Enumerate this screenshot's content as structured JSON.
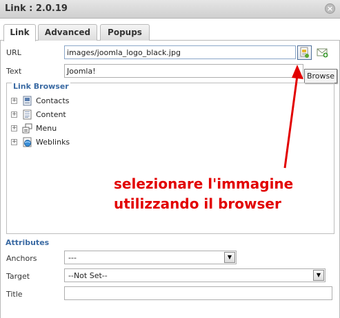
{
  "window": {
    "title": "Link : 2.0.19",
    "close_glyph": "×"
  },
  "tabs": [
    {
      "label": "Link",
      "active": true
    },
    {
      "label": "Advanced",
      "active": false
    },
    {
      "label": "Popups",
      "active": false
    }
  ],
  "form": {
    "url_label": "URL",
    "url_value": "images/joomla_logo_black.jpg",
    "text_label": "Text",
    "text_value": "Joomla!"
  },
  "tooltip": {
    "label": "Browse"
  },
  "link_browser": {
    "legend": "Link Browser",
    "items": [
      {
        "label": "Contacts",
        "icon": "contacts-icon"
      },
      {
        "label": "Content",
        "icon": "content-icon"
      },
      {
        "label": "Menu",
        "icon": "menu-icon"
      },
      {
        "label": "Weblinks",
        "icon": "weblinks-icon"
      }
    ]
  },
  "annotation": {
    "line1": "selezionare l'immagine",
    "line2": "utilizzando il browser",
    "color": "#e20000"
  },
  "attributes": {
    "heading": "Attributes",
    "anchors_label": "Anchors",
    "anchors_value": "---",
    "target_label": "Target",
    "target_value": "--Not Set--",
    "title_label": "Title",
    "title_value": ""
  },
  "colors": {
    "accent": "#3a6aa3"
  }
}
